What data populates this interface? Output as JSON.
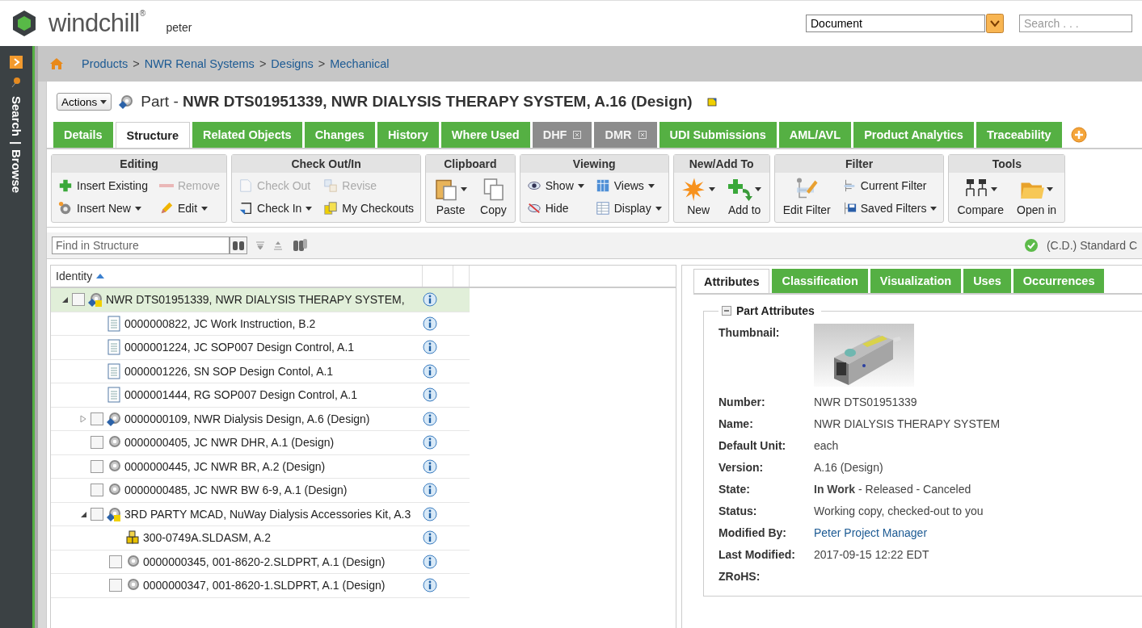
{
  "header": {
    "logo": "windchill$^{®}$",
    "user": "peter",
    "type_select": "Document",
    "search": {
      "placeholder": "Search . . ."
    }
  },
  "sidebar": {
    "links": [
      "Search",
      "Browse"
    ],
    "separator": "|"
  },
  "breadcrumb": {
    "items": [
      "Products",
      "NWR Renal Systems",
      "Designs",
      "Mechanical"
    ],
    "separator": ">"
  },
  "title_bar": {
    "actions": "Actions",
    "title": "Part - **NWR DTS01951339, NWR DIALYSIS THERAPY SYSTEM, A.16 (Design)**"
  },
  "tabs": [
    {
      "label": "Details",
      "selected": false,
      "disabled": false,
      "closable": false
    },
    {
      "label": "Structure",
      "selected": true,
      "disabled": false,
      "closable": false
    },
    {
      "label": "Related Objects",
      "selected": false,
      "disabled": false,
      "closable": false
    },
    {
      "label": "Changes",
      "selected": false,
      "disabled": false,
      "closable": false
    },
    {
      "label": "History",
      "selected": false,
      "disabled": false,
      "closable": false
    },
    {
      "label": "Where Used",
      "selected": false,
      "disabled": false,
      "closable": false
    },
    {
      "label": "DHF",
      "selected": false,
      "disabled": true,
      "closable": true
    },
    {
      "label": "DMR",
      "selected": false,
      "disabled": true,
      "closable": true
    },
    {
      "label": "UDI Submissions",
      "selected": false,
      "disabled": false,
      "closable": false
    },
    {
      "label": "AML/AVL",
      "selected": false,
      "disabled": false,
      "closable": false
    },
    {
      "label": "Product Analytics",
      "selected": false,
      "disabled": false,
      "closable": false
    },
    {
      "label": "Traceability",
      "selected": false,
      "disabled": false,
      "closable": false
    }
  ],
  "toolbar": [
    {
      "title": "Editing",
      "items": [
        {
          "label": "Insert Existing",
          "kind": "small",
          "dropdown": false,
          "disabled": false
        },
        {
          "label": "Remove",
          "kind": "small",
          "dropdown": false,
          "disabled": true
        },
        {
          "label": "Insert New",
          "kind": "small",
          "dropdown": true,
          "disabled": false
        },
        {
          "label": "Edit",
          "kind": "small",
          "dropdown": true,
          "disabled": false
        }
      ]
    },
    {
      "title": "Check Out/In",
      "items": [
        {
          "label": "Check Out",
          "kind": "small",
          "dropdown": false,
          "disabled": true
        },
        {
          "label": "Revise",
          "kind": "small",
          "dropdown": false,
          "disabled": true
        },
        {
          "label": "Check In",
          "kind": "small",
          "dropdown": true,
          "disabled": false
        },
        {
          "label": "My Checkouts",
          "kind": "small",
          "dropdown": false,
          "disabled": false
        }
      ]
    },
    {
      "title": "Clipboard",
      "items": [
        {
          "label": "Paste",
          "kind": "large",
          "dropdown": true,
          "disabled": false
        },
        {
          "label": "Copy",
          "kind": "large",
          "dropdown": false,
          "disabled": false
        }
      ]
    },
    {
      "title": "Viewing",
      "items": [
        {
          "label": "Show",
          "kind": "small",
          "dropdown": true,
          "disabled": false
        },
        {
          "label": "Views",
          "kind": "small",
          "dropdown": true,
          "disabled": false
        },
        {
          "label": "Hide",
          "kind": "small",
          "dropdown": false,
          "disabled": false
        },
        {
          "label": "Display",
          "kind": "small",
          "dropdown": true,
          "disabled": false
        }
      ]
    },
    {
      "title": "New/Add To",
      "items": [
        {
          "label": "New",
          "kind": "large",
          "dropdown": true,
          "disabled": false
        },
        {
          "label": "Add to",
          "kind": "large",
          "dropdown": true,
          "disabled": false
        }
      ]
    },
    {
      "title": "Filter",
      "items": [
        {
          "label": "Edit Filter",
          "kind": "large",
          "dropdown": false,
          "disabled": false
        },
        {
          "label": "Current Filter",
          "kind": "small",
          "dropdown": false,
          "disabled": false
        },
        {
          "label": "Saved Filters",
          "kind": "small",
          "dropdown": true,
          "disabled": false
        }
      ]
    },
    {
      "title": "Tools",
      "items": [
        {
          "label": "Compare",
          "kind": "large",
          "dropdown": true,
          "disabled": false
        },
        {
          "label": "Open in",
          "kind": "large",
          "dropdown": true,
          "disabled": false
        }
      ]
    }
  ],
  "find_bar": {
    "placeholder": "Find in Structure",
    "status": "(C.D.) Standard C"
  },
  "tree": {
    "columns": [
      "Identity"
    ],
    "sort_ascending": true,
    "rows": [
      {
        "label": "NWR DTS01951339, NWR DIALYSIS THERAPY SYSTEM,",
        "kind": "assembly",
        "checkbox": true,
        "checked": false,
        "expanded": true,
        "selected": true,
        "children": [
          {
            "label": "0000000822, JC Work Instruction, B.2",
            "kind": "document",
            "checkbox": false,
            "selected": false
          },
          {
            "label": "0000001224, JC SOP007 Design Control, A.1",
            "kind": "document",
            "checkbox": false,
            "selected": false
          },
          {
            "label": "0000001226, SN SOP Design Contol, A.1",
            "kind": "document",
            "checkbox": false,
            "selected": false
          },
          {
            "label": "0000001444, RG SOP007 Design Control, A.1",
            "kind": "document",
            "checkbox": false,
            "selected": false
          },
          {
            "label": "0000000109, NWR Dialysis Design, A.6 (Design)",
            "kind": "variant",
            "checkbox": true,
            "checked": false,
            "expanded": false,
            "selected": false
          },
          {
            "label": "0000000405, JC NWR DHR, A.1 (Design)",
            "kind": "part",
            "checkbox": true,
            "checked": false,
            "selected": false
          },
          {
            "label": "0000000445, JC NWR BR, A.2 (Design)",
            "kind": "part",
            "checkbox": true,
            "checked": false,
            "selected": false
          },
          {
            "label": "0000000485, JC NWR BW 6-9, A.1 (Design)",
            "kind": "part",
            "checkbox": true,
            "checked": false,
            "selected": false
          },
          {
            "label": "3RD PARTY MCAD, NuWay Dialysis Accessories Kit, A.3",
            "kind": "assembly",
            "checkbox": true,
            "checked": false,
            "expanded": true,
            "selected": false,
            "children": [
              {
                "label": "300-0749A.SLDASM, A.2",
                "kind": "cad",
                "checkbox": false,
                "selected": false
              },
              {
                "label": "0000000345, 001-8620-2.SLDPRT, A.1 (Design)",
                "kind": "part",
                "checkbox": true,
                "checked": false,
                "selected": false
              },
              {
                "label": "0000000347, 001-8620-1.SLDPRT, A.1 (Design)",
                "kind": "part",
                "checkbox": true,
                "checked": false,
                "selected": false
              }
            ]
          }
        ]
      }
    ]
  },
  "details": {
    "tabs": [
      {
        "label": "Attributes",
        "selected": true
      },
      {
        "label": "Classification",
        "selected": false
      },
      {
        "label": "Visualization",
        "selected": false
      },
      {
        "label": "Uses",
        "selected": false
      },
      {
        "label": "Occurrences",
        "selected": false
      }
    ],
    "section": {
      "title": "Part Attributes",
      "expanded": true,
      "fields": [
        {
          "label": "Thumbnail:",
          "kind": "picture"
        },
        {
          "label": "Number:",
          "kind": "text",
          "value": "NWR DTS01951339"
        },
        {
          "label": "Name:",
          "kind": "text",
          "value": "NWR DIALYSIS THERAPY SYSTEM"
        },
        {
          "label": "Default Unit:",
          "kind": "text",
          "value": "each"
        },
        {
          "label": "Version:",
          "kind": "text",
          "value": "A.16 (Design)"
        },
        {
          "label": "State:",
          "kind": "text",
          "value": "**In Work** - Released - Canceled"
        },
        {
          "label": "Status:",
          "kind": "text",
          "value": "Working copy, checked-out to you"
        },
        {
          "label": "Modified By:",
          "kind": "link",
          "value": "Peter Project Manager"
        },
        {
          "label": "Last Modified:",
          "kind": "text",
          "value": "2017-09-15 12:22 EDT"
        },
        {
          "label": "ZRoHS:",
          "kind": "text"
        }
      ]
    }
  }
}
